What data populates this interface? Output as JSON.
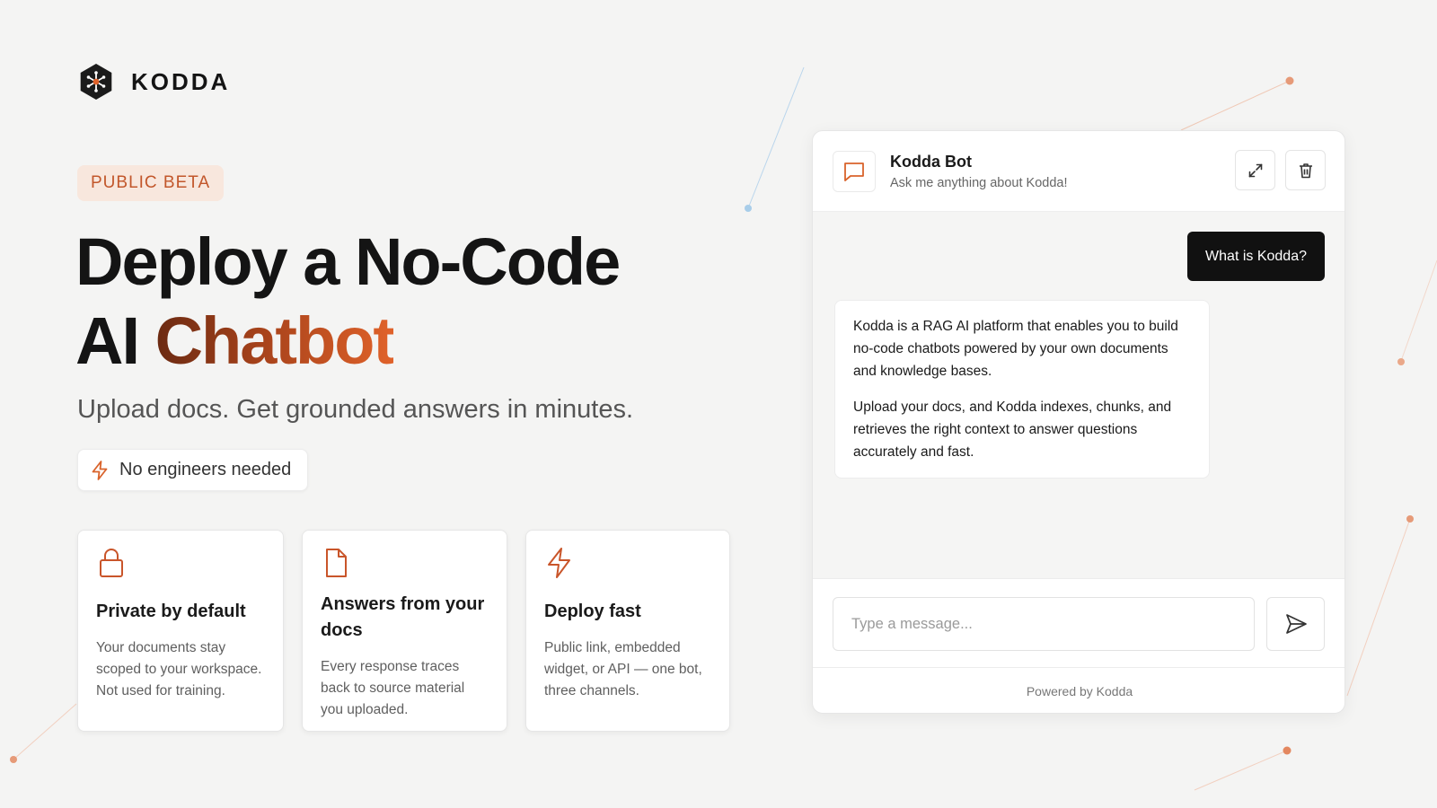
{
  "brand": {
    "name": "KODDA",
    "logo_icon": "hexagon-network-icon"
  },
  "hero": {
    "badge": "PUBLIC BETA",
    "title_line1": "Deploy a No-Code",
    "title_line2_plain": "AI ",
    "title_line2_accent": "Chatbot",
    "subtitle": "Upload docs. Get grounded answers in minutes.",
    "chip": {
      "icon": "bolt-icon",
      "label": "No engineers needed"
    }
  },
  "features": [
    {
      "icon": "lock-icon",
      "title": "Private by default",
      "body": "Your documents stay scoped to your workspace. Not used for training."
    },
    {
      "icon": "document-icon",
      "title": "Answers from your docs",
      "body": "Every response traces back to source material you uploaded."
    },
    {
      "icon": "bolt-icon",
      "title": "Deploy fast",
      "body": "Public link, embedded widget, or API — one bot, three channels."
    }
  ],
  "chat": {
    "bot_name": "Kodda Bot",
    "tagline": "Ask me anything about Kodda!",
    "avatar_icon": "chat-bubble-icon",
    "expand_icon": "expand-icon",
    "delete_icon": "trash-icon",
    "messages": {
      "user": "What is Kodda?",
      "bot_p1": "Kodda is a RAG AI platform that enables you to build no-code chatbots powered by your own documents and knowledge bases.",
      "bot_p2": "Upload your docs, and Kodda indexes, chunks, and retrieves the right context to answer questions accurately and fast."
    },
    "input_placeholder": "Type a message...",
    "send_icon": "send-icon",
    "footer": "Powered by Kodda"
  },
  "colors": {
    "accent": "#d9632b",
    "accent_dark": "#6b2a12",
    "badge_bg": "#f8e7dd",
    "background": "#f4f4f3",
    "user_bubble": "#111111"
  }
}
